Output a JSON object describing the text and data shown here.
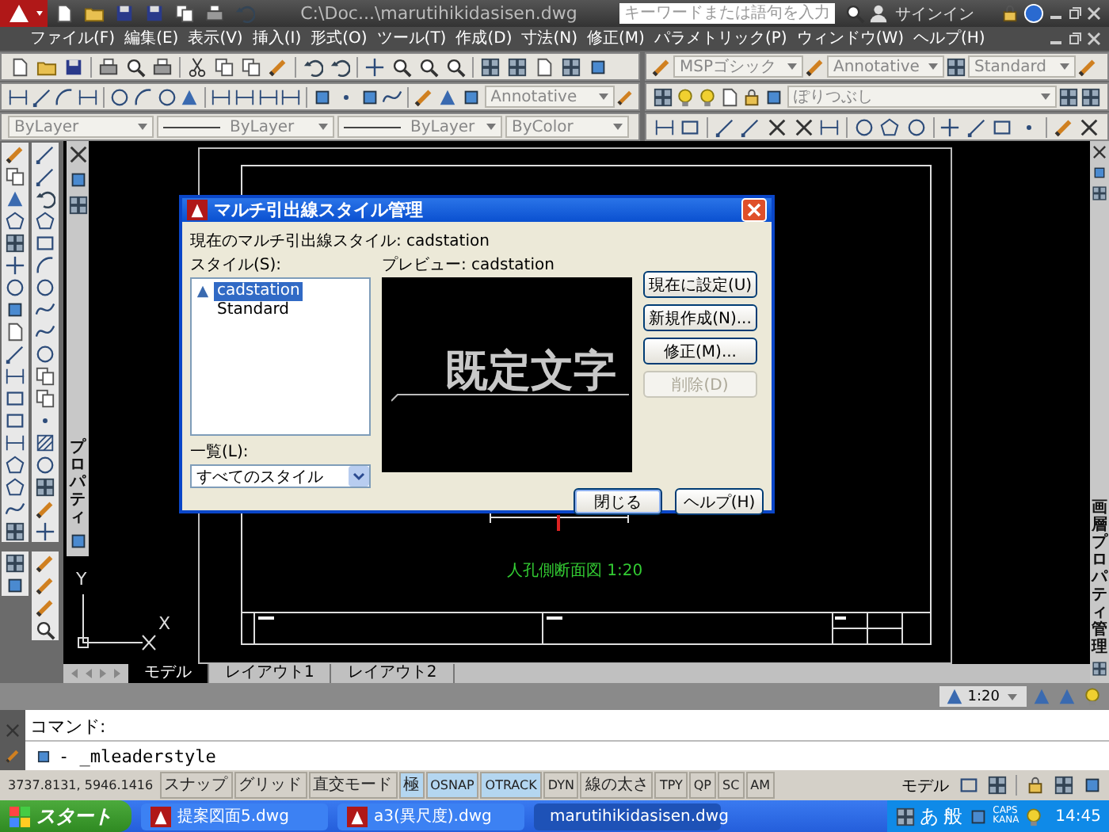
{
  "title_bar": {
    "title": "C:\\Doc...\\marutihikidasisen.dwg",
    "search": {
      "placeholder": "キーワードまたは語句を入力"
    },
    "sign_in": "サインイン"
  },
  "menu": [
    {
      "label": "ファイル(F)"
    },
    {
      "label": "編集(E)"
    },
    {
      "label": "表示(V)"
    },
    {
      "label": "挿入(I)"
    },
    {
      "label": "形式(O)"
    },
    {
      "label": "ツール(T)"
    },
    {
      "label": "作成(D)"
    },
    {
      "label": "寸法(N)"
    },
    {
      "label": "修正(M)"
    },
    {
      "label": "パラメトリック(P)"
    },
    {
      "label": "ウィンドウ(W)"
    },
    {
      "label": "ヘルプ(H)"
    }
  ],
  "toolbars": {
    "text_font": "MSPゴシック",
    "text_scale": "Annotative",
    "dim_style": "Standard",
    "dim_scale": "Annotative",
    "layer": "ぽりつぶし",
    "color_setting": "ByLayer",
    "linetype": "ByLayer",
    "lineweight": "ByLayer",
    "plot_style": "ByColor"
  },
  "left_palette": {
    "title": "プロパティ"
  },
  "right_palette": {
    "title": "画層プロパティ管理"
  },
  "canvas": {
    "view_label": "人孔側断面図 1:20",
    "ucs_y": "Y",
    "ucs_x": "X"
  },
  "layout_tabs": [
    {
      "label": "モデル",
      "selected": true
    },
    {
      "label": "レイアウト1",
      "selected": false
    },
    {
      "label": "レイアウト2",
      "selected": false
    }
  ],
  "dialog": {
    "title": "マルチ引出線スタイル管理",
    "current_style": "現在のマルチ引出線スタイル: cadstation",
    "styles_label": "スタイル(S):",
    "styles": [
      {
        "name": "cadstation",
        "selected": true,
        "annotative": true
      },
      {
        "name": "Standard",
        "selected": false,
        "annotative": false
      }
    ],
    "list_label": "一覧(L):",
    "list_value": "すべてのスタイル",
    "preview_label": "プレビュー: cadstation",
    "preview_text": "既定文字",
    "side_buttons": [
      {
        "label": "現在に設定(U)",
        "disabled": false
      },
      {
        "label": "新規作成(N)...",
        "disabled": false
      },
      {
        "label": "修正(M)...",
        "disabled": false
      },
      {
        "label": "削除(D)",
        "disabled": true
      }
    ],
    "bottom_buttons": [
      {
        "label": "閉じる",
        "default": true
      },
      {
        "label": "ヘルプ(H)",
        "default": false
      }
    ]
  },
  "annotation_scale": "1:20",
  "command": {
    "history": "コマンド:",
    "input": "- _mleaderstyle"
  },
  "status_bar": {
    "coordinates": "3737.8131, 5946.1416",
    "toggles": [
      {
        "label": "スナップ",
        "on": false
      },
      {
        "label": "グリッド",
        "on": false
      },
      {
        "label": "直交モード",
        "on": false
      },
      {
        "label": "極",
        "on": true
      },
      {
        "label": "OSNAP",
        "on": true
      },
      {
        "label": "OTRACK",
        "on": true
      },
      {
        "label": "DYN",
        "on": false
      },
      {
        "label": "線の太さ",
        "on": false
      },
      {
        "label": "TPY",
        "on": false
      },
      {
        "label": "QP",
        "on": false
      },
      {
        "label": "SC",
        "on": false
      },
      {
        "label": "AM",
        "on": false
      }
    ],
    "model": "モデル"
  },
  "taskbar": {
    "start": "スタート",
    "tasks": [
      {
        "label": "提案図面5.dwg",
        "selected": false
      },
      {
        "label": "a3(異尺度).dwg",
        "selected": false
      },
      {
        "label": "marutihikidasisen.dwg",
        "selected": true
      }
    ],
    "ime_mode": "あ",
    "ime_dict": "般",
    "caps": "CAPS",
    "kana": "KANA",
    "clock": "14:45"
  }
}
